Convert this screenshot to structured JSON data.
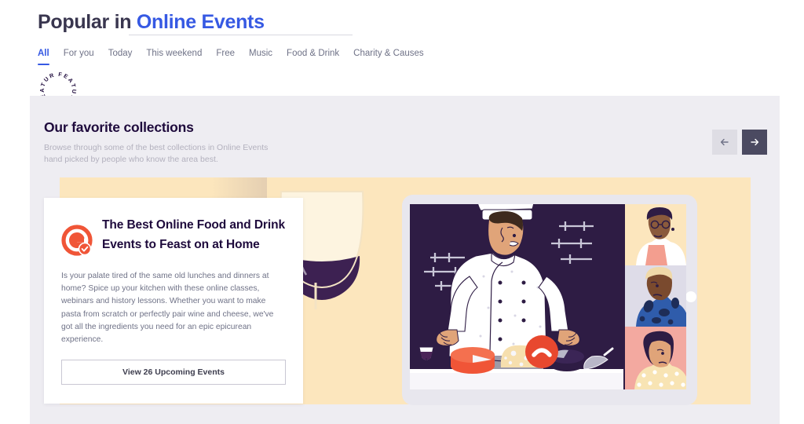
{
  "header": {
    "title_prefix": "Popular in ",
    "title_accent": "Online Events",
    "accent_color": "#3659e3"
  },
  "tabs": [
    {
      "label": "All",
      "active": true
    },
    {
      "label": "For you",
      "active": false
    },
    {
      "label": "Today",
      "active": false
    },
    {
      "label": "This weekend",
      "active": false
    },
    {
      "label": "Free",
      "active": false
    },
    {
      "label": "Music",
      "active": false
    },
    {
      "label": "Food & Drink",
      "active": false
    },
    {
      "label": "Charity & Causes",
      "active": false
    }
  ],
  "featured_badge": {
    "text": "FEATURED · FEATURED · "
  },
  "collections": {
    "title": "Our favorite collections",
    "subtitle_line1": "Browse through some of the best collections in Online Events",
    "subtitle_line2": "hand picked by people who know the area best.",
    "prev_label": "Previous",
    "next_label": "Next"
  },
  "card": {
    "title": "The Best Online Food and Drink Events to Feast on at Home",
    "body": "Is your palate tired of the same old lunches and dinners at home? Spice up your kitchen with these online classes, webinars and history lessons. Whether you want to make pasta from scratch or perfectly pair wine and cheese, we've got all the ingredients you need for an epic epicurean experience.",
    "button_label": "View 26 Upcoming Events",
    "logo_name": "eventbrite-verified-logo"
  },
  "illustration": {
    "name": "online-cooking-class-video-call",
    "description": "Tablet screen showing a video call with a chef presenting cheeses, three participant thumbnails, a wine glass in the foreground",
    "colors": {
      "banner_cream": "#fce6bd",
      "screen_dark": "#2e1c44",
      "tablet_body": "#e8e7ee",
      "cheese_red": "#f05537",
      "cheese_yellow": "#f7e0b0",
      "end_call_red": "#e8482f",
      "panel_gray": "#eeedf2"
    }
  }
}
